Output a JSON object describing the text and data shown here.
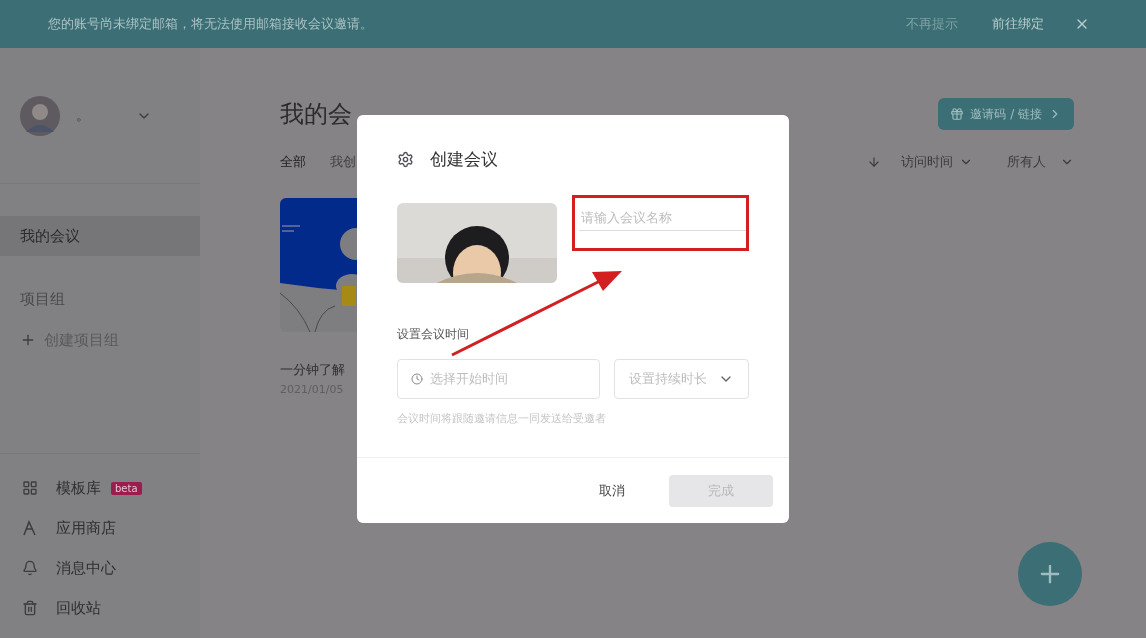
{
  "banner": {
    "message": "您的账号尚未绑定邮箱，将无法使用邮箱接收会议邀请。",
    "dismiss_label": "不再提示",
    "bind_label": "前往绑定"
  },
  "sidebar": {
    "user_name": "。",
    "items": [
      {
        "label": "我的会议",
        "selected": true
      }
    ],
    "group_heading": "项目组",
    "create_group": "创建项目组",
    "bottom_items": [
      {
        "kind": "template",
        "label": "模板库",
        "badge": "beta"
      },
      {
        "kind": "store",
        "label": "应用商店"
      },
      {
        "kind": "bell",
        "label": "消息中心"
      },
      {
        "kind": "trash",
        "label": "回收站"
      }
    ]
  },
  "main": {
    "title": "我的会",
    "invite_button": "邀请码 / 链接",
    "tabs": [
      {
        "label": "全部",
        "selected": true
      },
      {
        "label": "我创",
        "selected": false
      }
    ],
    "sort_label": "访问时间",
    "owner_filter": "所有人",
    "cards": [
      {
        "title": "一分钟了解",
        "date": "2021/01/05"
      }
    ]
  },
  "dialog": {
    "title": "创建会议",
    "name_placeholder": "请输入会议名称",
    "time_label": "设置会议时间",
    "start_placeholder": "选择开始时间",
    "duration_placeholder": "设置持续时长",
    "hint": "会议时间将跟随邀请信息一同发送给受邀者",
    "cancel": "取消",
    "done": {
      "label": "完成",
      "disabled": true
    }
  }
}
